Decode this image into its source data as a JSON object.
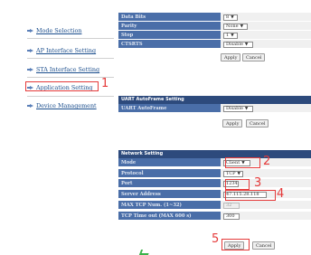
{
  "sidebar": {
    "items": [
      {
        "label": "Mode Selection"
      },
      {
        "label": "AP Interface Setting"
      },
      {
        "label": "STA Interface Setting"
      },
      {
        "label": "Application Setting"
      },
      {
        "label": "Device Management"
      }
    ]
  },
  "serial": {
    "rows": [
      {
        "label": "Data Bits",
        "value": "8"
      },
      {
        "label": "Parity",
        "value": "None"
      },
      {
        "label": "Stop",
        "value": "1"
      },
      {
        "label": "CTSRTS",
        "value": "Disable"
      }
    ],
    "apply_label": "Apply",
    "cancel_label": "Cancel"
  },
  "uart": {
    "title": "UART AutoFrame Setting",
    "rows": [
      {
        "label": "UART AutoFrame",
        "value": "Disable"
      }
    ],
    "apply_label": "Apply",
    "cancel_label": "Cancel"
  },
  "network": {
    "title": "Network Setting",
    "rows": [
      {
        "label": "Mode",
        "value": "Client"
      },
      {
        "label": "Protocol",
        "value": "TCP"
      },
      {
        "label": "Port",
        "value": "1234"
      },
      {
        "label": "Server Address",
        "value": "47.115.28.118"
      },
      {
        "label": "MAX TCP Num. (1~32)",
        "value": "32"
      },
      {
        "label": "TCP Time out (MAX 600 s)",
        "value": "300"
      }
    ],
    "apply_label": "Apply",
    "cancel_label": "Cancel"
  },
  "annotations": [
    "1",
    "2",
    "3",
    "4",
    "5"
  ],
  "colors": {
    "highlight": "#e53a3a",
    "label_bg": "#4a6ea8",
    "header_bg": "#2d4a7c",
    "link": "#1a4d8c"
  }
}
